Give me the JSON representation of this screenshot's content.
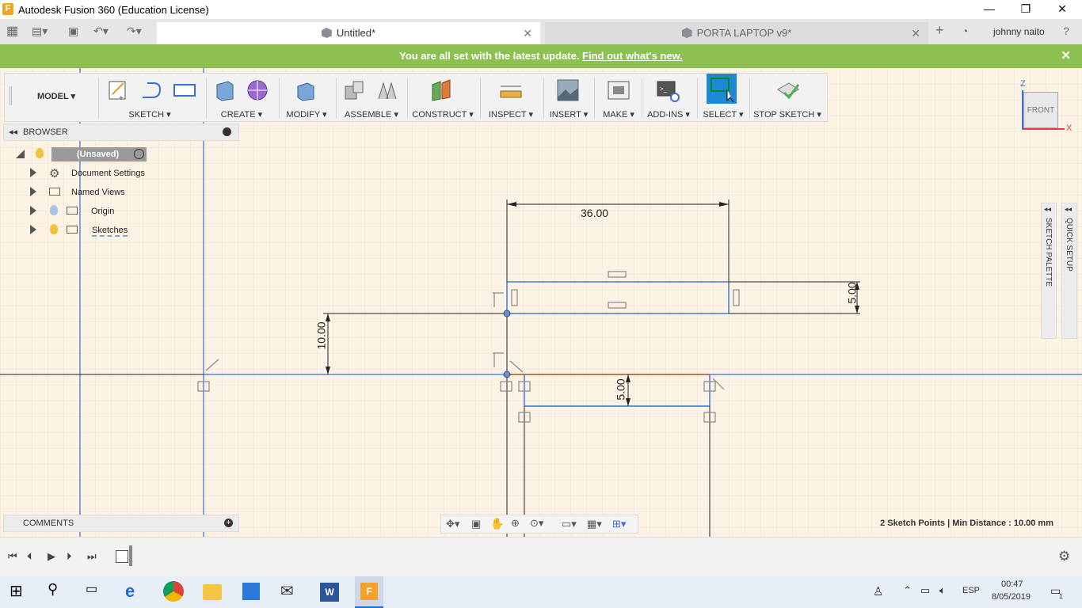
{
  "window": {
    "title": "Autodesk Fusion 360 (Education License)",
    "user": "johnny naito"
  },
  "tabs": [
    {
      "label": "Untitled*"
    },
    {
      "label": "PORTA LAPTOP v9*"
    }
  ],
  "update_bar": {
    "text": "You are all set with the latest update.",
    "link": "Find out what's new."
  },
  "toolbar": {
    "workspace": "MODEL",
    "groups": [
      "SKETCH",
      "CREATE",
      "MODIFY",
      "ASSEMBLE",
      "CONSTRUCT",
      "INSPECT",
      "INSERT",
      "MAKE",
      "ADD-INS",
      "SELECT",
      "STOP SKETCH"
    ]
  },
  "viewcube": {
    "label": "FRONT",
    "axis_z": "Z",
    "axis_x": "X"
  },
  "browser": {
    "title": "BROWSER",
    "root": "(Unsaved)",
    "items": [
      "Document Settings",
      "Named Views",
      "Origin",
      "Sketches"
    ]
  },
  "dimensions": {
    "top_width": "36.00",
    "right_height": "5.00",
    "left_height": "10.00",
    "lower_height": "5.00"
  },
  "side_panels": {
    "sketch_palette": "SKETCH PALETTE",
    "quick_setup": "QUICK SETUP"
  },
  "comments": {
    "title": "COMMENTS"
  },
  "status": "2 Sketch Points | Min Distance : 10.00 mm",
  "taskbar": {
    "lang": "ESP",
    "time": "00:47",
    "date": "8/05/2019",
    "notifications": "1"
  },
  "colors": {
    "accent_green": "#8cc152",
    "sketch_blue": "#3c6fd6",
    "canvas": "#fdf3e5"
  }
}
